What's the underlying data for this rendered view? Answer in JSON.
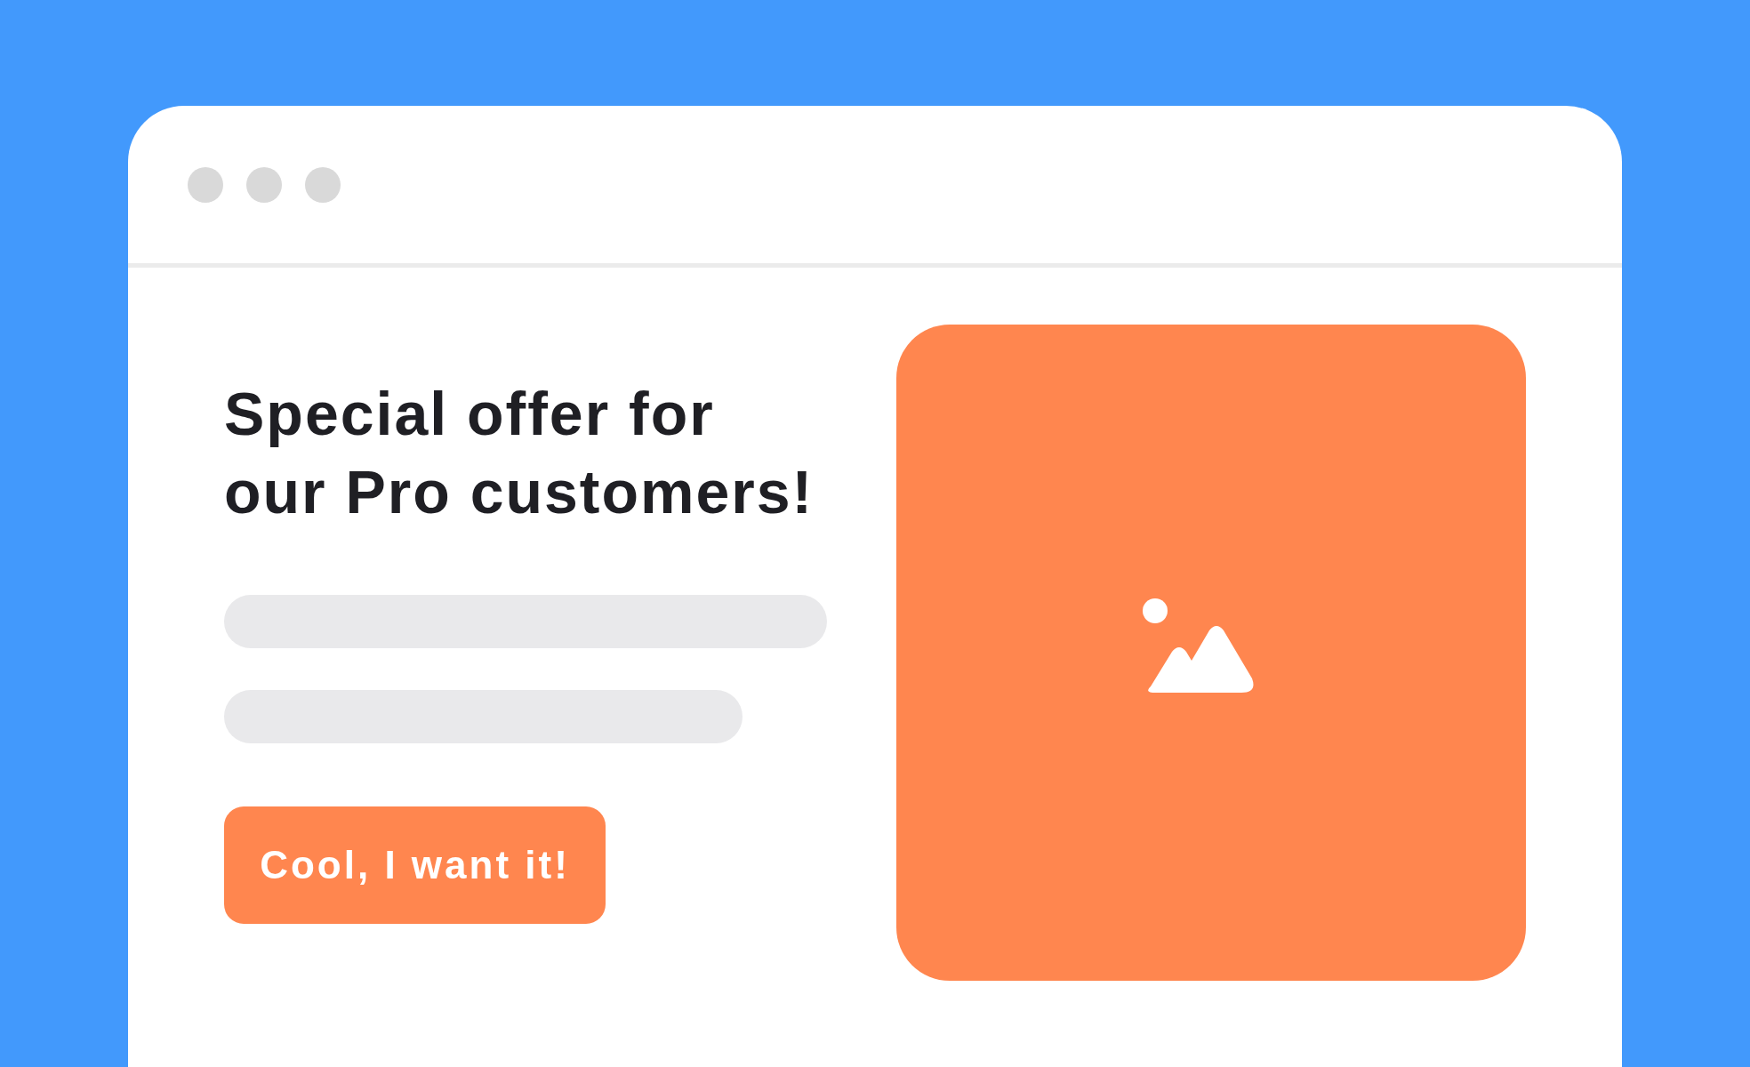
{
  "window": {
    "controls": [
      {
        "kind": "dot"
      },
      {
        "kind": "dot"
      },
      {
        "kind": "dot"
      }
    ]
  },
  "offer": {
    "heading_lines": [
      "Special offer for",
      "our Pro customers!"
    ],
    "text_bars": [
      {
        "kind": "long"
      },
      {
        "kind": "short"
      }
    ],
    "button": "Cool, I want it!"
  },
  "image": {
    "kind": "placeholder"
  }
}
